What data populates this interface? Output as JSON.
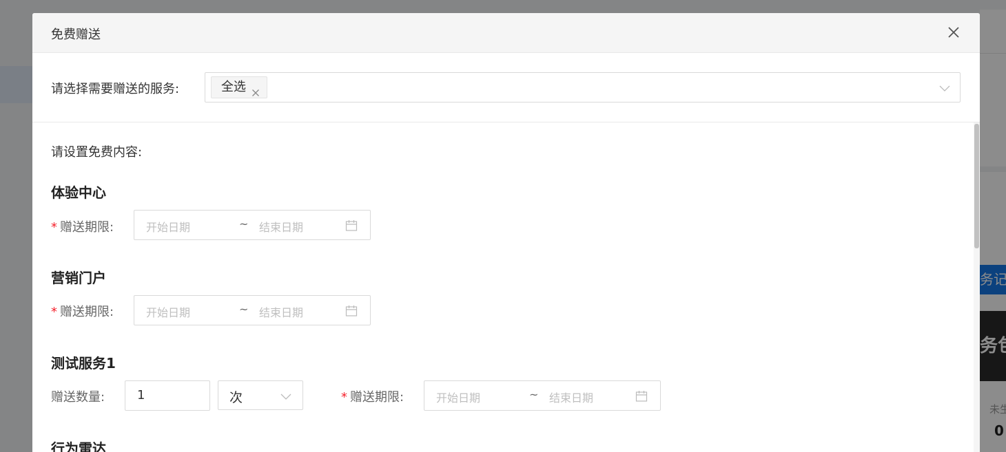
{
  "modal": {
    "title": "免费赠送",
    "close_icon": "close-icon"
  },
  "service_select": {
    "label": "请选择需要赠送的服务:",
    "selected_tag": "全选"
  },
  "content": {
    "label": "请设置免费内容:",
    "sections": [
      {
        "title": "体验中心",
        "period_label": "赠送期限:",
        "start_placeholder": "开始日期",
        "separator": "~",
        "end_placeholder": "结束日期"
      },
      {
        "title": "营销门户",
        "period_label": "赠送期限:",
        "start_placeholder": "开始日期",
        "separator": "~",
        "end_placeholder": "结束日期"
      },
      {
        "title": "测试服务1",
        "quantity_label": "赠送数量:",
        "quantity_value": "1",
        "unit_value": "次",
        "period_label": "赠送期限:",
        "start_placeholder": "开始日期",
        "separator": "~",
        "end_placeholder": "结束日期"
      },
      {
        "title": "行为雷达"
      }
    ]
  },
  "background": {
    "blue_button": "务记",
    "dark_card": "务包",
    "small_label": "未生",
    "small_number": "0"
  },
  "colors": {
    "required": "#f5222d",
    "primary": "#1477e6",
    "placeholder": "#bfbfbf"
  }
}
